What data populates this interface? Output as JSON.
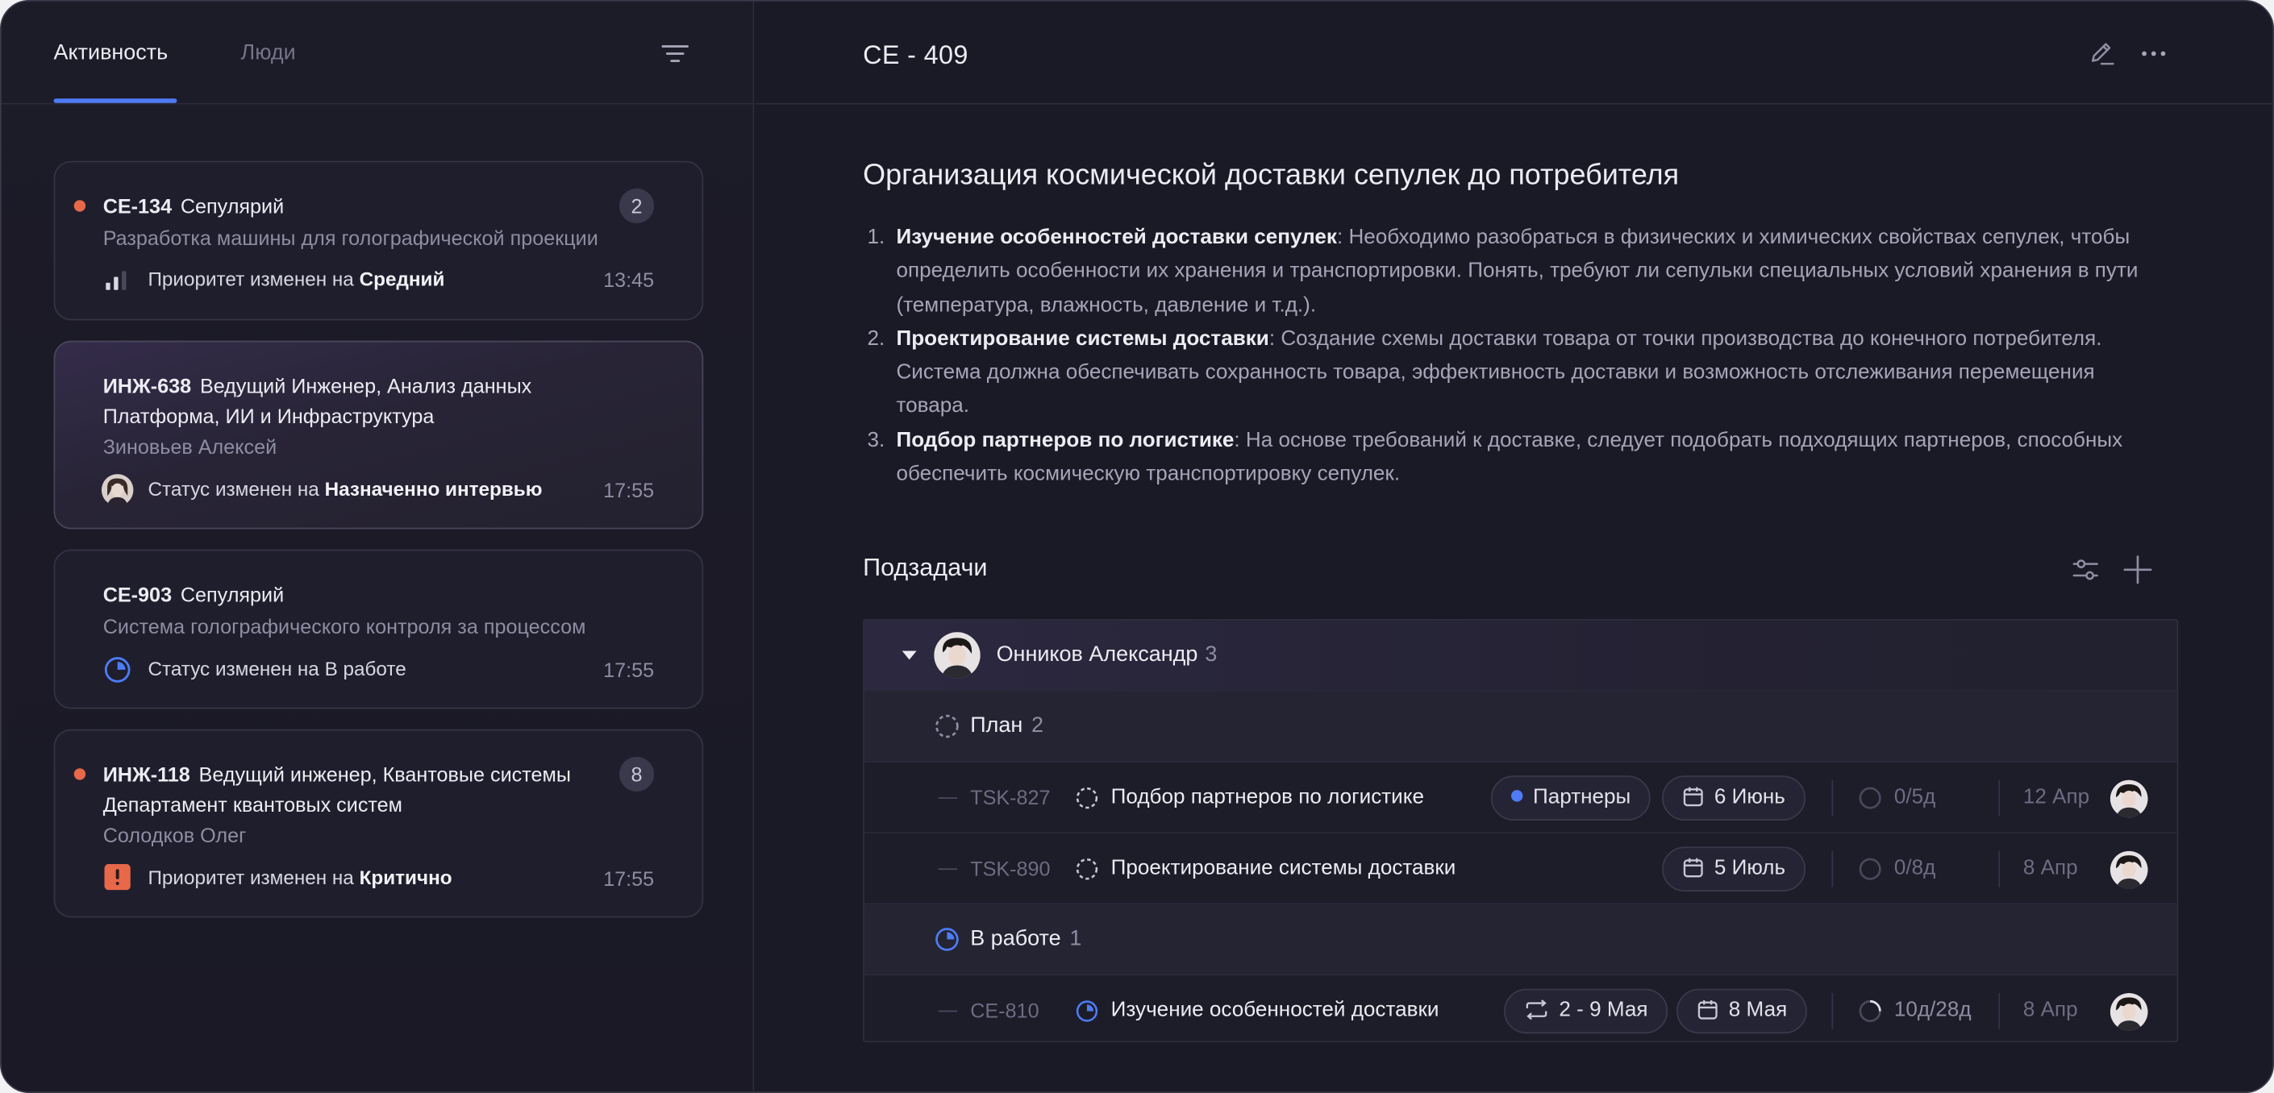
{
  "left": {
    "tabs": [
      {
        "label": "Активность",
        "active": true
      },
      {
        "label": "Люди",
        "active": false
      }
    ],
    "filter_icon": "filter-icon",
    "cards": [
      {
        "id": "CE-134",
        "title": "Сепулярий",
        "subtitle": "Разработка машины для голографической проекции",
        "unread": true,
        "badge": "2",
        "event_prefix": "Приоритет изменен на ",
        "event_value": "Средний",
        "event_icon": "priority-medium-icon",
        "time": "13:45"
      },
      {
        "id": "ИНЖ-638",
        "title": "Ведущий Инженер, Анализ данных",
        "title_line2": "Платформа, ИИ и Инфраструктура",
        "subtitle": "Зиновьев Алексей",
        "unread": false,
        "selected": true,
        "event_prefix": "Статус изменен на ",
        "event_value": "Назначенно интервью",
        "event_icon": "user-avatar",
        "time": "17:55"
      },
      {
        "id": "CE-903",
        "title": "Сепулярий",
        "subtitle": "Система голографического контроля за процессом",
        "unread": false,
        "event_prefix": "Статус изменен на ",
        "event_value": "В работе",
        "event_icon": "status-in-progress-icon",
        "time": "17:55"
      },
      {
        "id": "ИНЖ-118",
        "title": "Ведущий инженер, Квантовые системы",
        "title_line2": "Департамент квантовых систем",
        "subtitle": "Солодков Олег",
        "unread": true,
        "badge": "8",
        "event_prefix": "Приоритет изменен на ",
        "event_value": "Критично",
        "event_icon": "priority-critical-icon",
        "time": "17:55"
      }
    ]
  },
  "issue": {
    "id": "CE - 409",
    "title": "Организация космической доставки сепулек до потребителя",
    "description": [
      {
        "num": "1.",
        "bold": "Изучение особенностей доставки сепулек",
        "text": ": Необходимо разобраться в физических и химических свойствах сепулек, чтобы определить особенности их хранения и транспортировки. Понять, требуют ли сепульки специальных условий хранения в пути (температура, влажность, давление и т.д.)."
      },
      {
        "num": "2.",
        "bold": "Проектирование системы доставки",
        "text": ": Создание схемы доставки товара от точки производства до конечного потребителя. Система должна обеспечивать сохранность товара, эффективность доставки и возможность отслеживания перемещения товара."
      },
      {
        "num": "3.",
        "bold": "Подбор партнеров по логистике",
        "text": ": На основе требований к доставке, следует подобрать подходящих партнеров, способных обеспечить космическую транспортировку сепулек."
      }
    ],
    "actions": [
      "edit-icon",
      "more-icon"
    ]
  },
  "subtasks": {
    "title": "Подзадачи",
    "assignee": {
      "name": "Онников Александр",
      "count": "3"
    },
    "groups": [
      {
        "status": "План",
        "count": "2",
        "status_icon": "status-planned-icon",
        "tasks": [
          {
            "id": "TSK-827",
            "name": "Подбор партнеров по логистике",
            "tag": "Партнеры",
            "due": "6 Июнь",
            "progress": "0/5д",
            "date": "12 Апр"
          },
          {
            "id": "TSK-890",
            "name": "Проектирование системы доставки",
            "due": "5 Июль",
            "progress": "0/8д",
            "date": "8 Апр"
          }
        ]
      },
      {
        "status": "В работе",
        "count": "1",
        "status_icon": "status-in-progress-icon",
        "tasks": [
          {
            "id": "CE-810",
            "name": "Изучение особенностей доставки",
            "range": "2 - 9 Мая",
            "due": "8 Мая",
            "progress": "10д/28д",
            "date": "8 Апр"
          }
        ]
      }
    ]
  },
  "colors": {
    "accent": "#4d7cf5",
    "unread_dot": "#e8684a",
    "critical": "#e8684a",
    "background": "#1a1926"
  }
}
